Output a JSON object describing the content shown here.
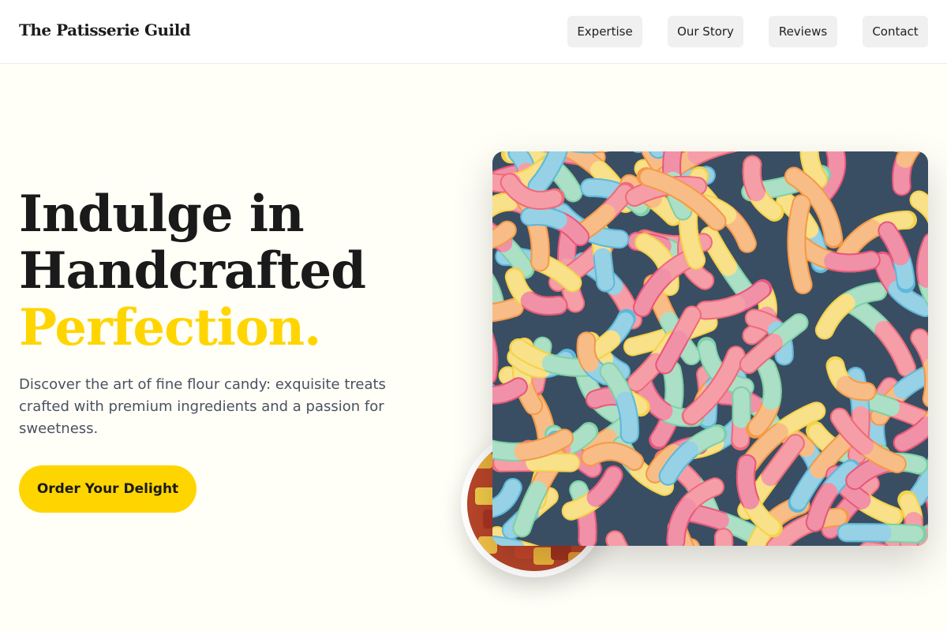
{
  "header": {
    "brand": "The Patisserie Guild",
    "nav": [
      {
        "label": "Expertise"
      },
      {
        "label": "Our Story"
      },
      {
        "label": "Reviews"
      },
      {
        "label": "Contact"
      }
    ]
  },
  "hero": {
    "title_line1": "Indulge in",
    "title_line2": "Handcrafted",
    "title_accent": "Perfection.",
    "description": "Discover the art of fine flour candy: exquisite treats crafted with premium ingredients and a passion for sweetness.",
    "cta_label": "Order Your Delight"
  },
  "colors": {
    "accent": "#ffd500",
    "background": "#fffef7",
    "text": "#1a1a1a",
    "muted_text": "#4a5260"
  }
}
